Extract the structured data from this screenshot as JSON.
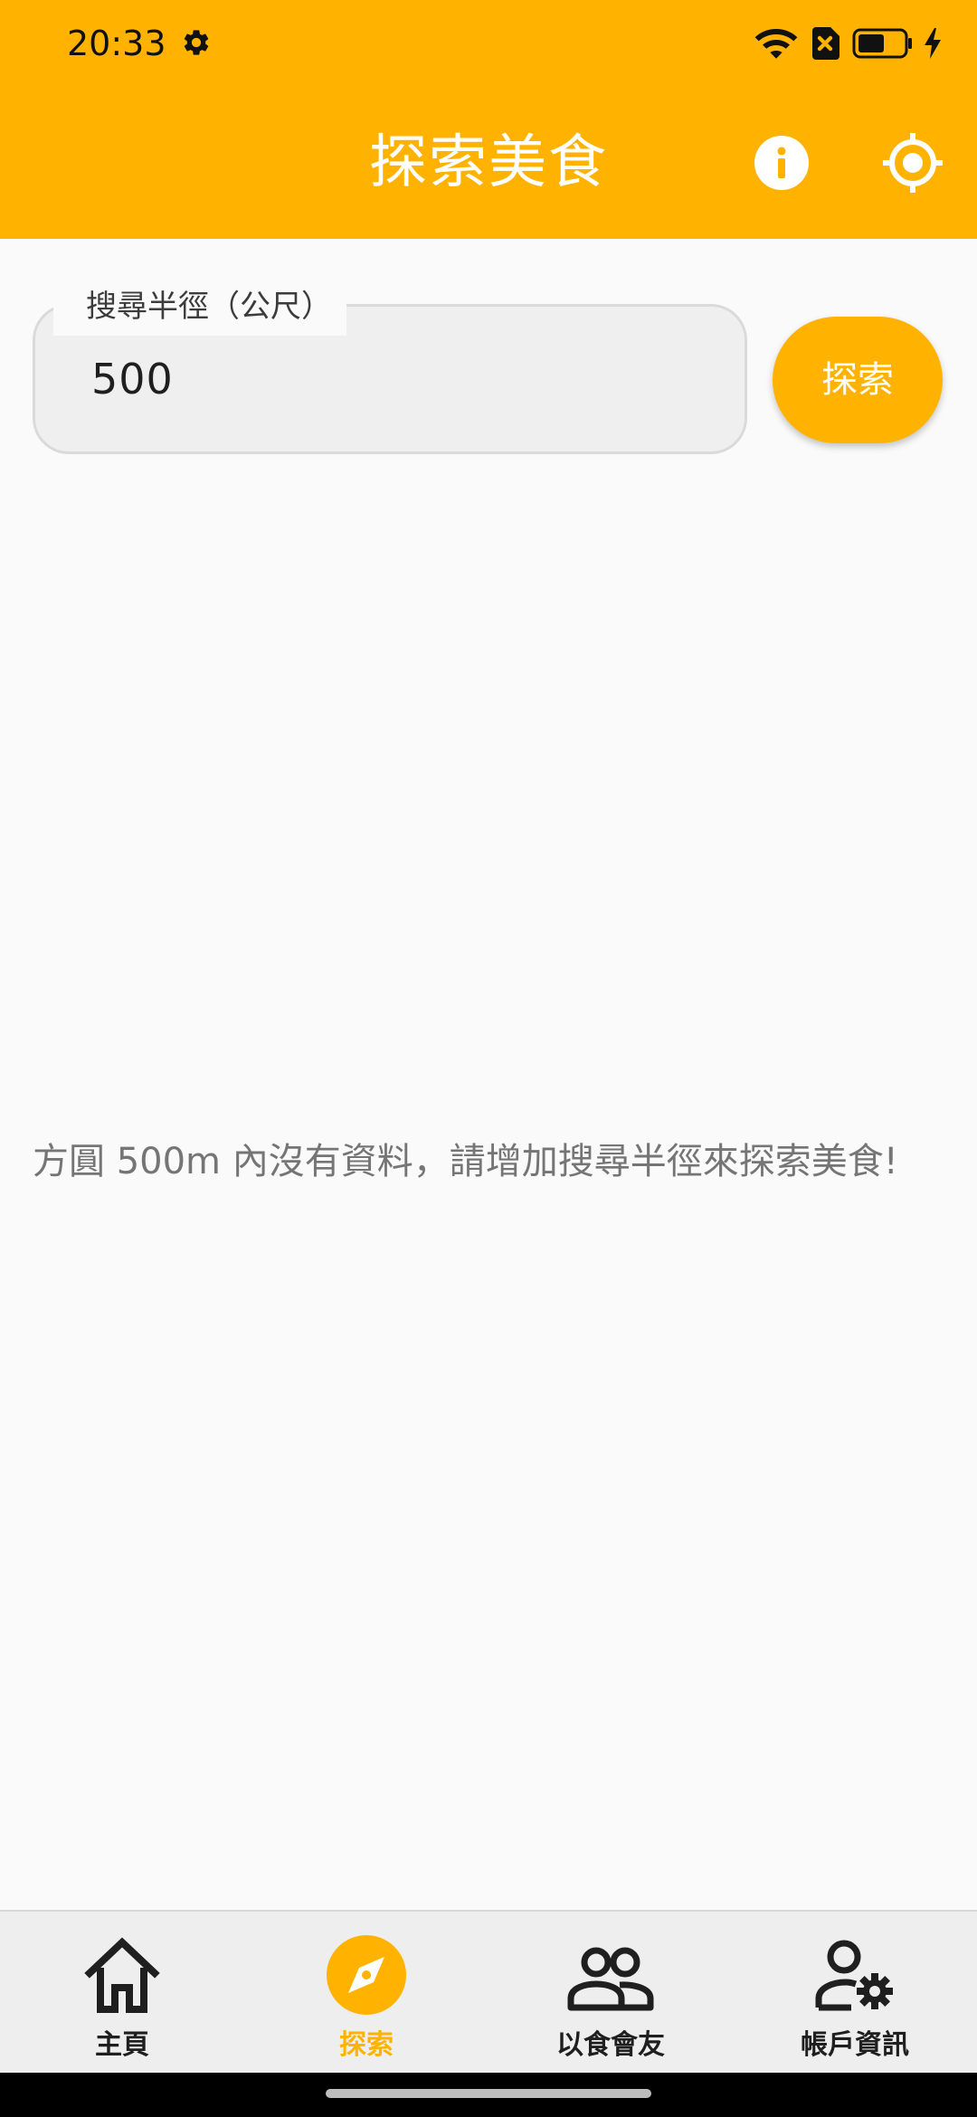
{
  "status_bar": {
    "time": "20:33",
    "icons": [
      "settings-gear-icon",
      "wifi-icon",
      "no-sim-icon",
      "battery-icon",
      "charging-bolt-icon"
    ]
  },
  "app_bar": {
    "title": "探索美食",
    "actions": [
      "info-icon",
      "my-location-icon"
    ]
  },
  "search": {
    "radius_label": "搜尋半徑（公尺）",
    "radius_value": "500",
    "button_label": "探索"
  },
  "results": {
    "empty_message": "方圓 500m 內沒有資料，請增加搜尋半徑來探索美食!"
  },
  "bottom_nav": {
    "active_index": 1,
    "items": [
      {
        "label": "主頁",
        "icon": "home-icon"
      },
      {
        "label": "探索",
        "icon": "explore-compass-icon"
      },
      {
        "label": "以食會友",
        "icon": "group-icon"
      },
      {
        "label": "帳戶資訊",
        "icon": "manage-account-icon"
      }
    ]
  },
  "colors": {
    "accent": "#FFB300",
    "app_bar_text": "#FFFFFF",
    "background": "#FAFAFA",
    "nav_background": "#EEEEEE",
    "inactive_icon": "#1F1F1F",
    "message_text": "#757575"
  }
}
